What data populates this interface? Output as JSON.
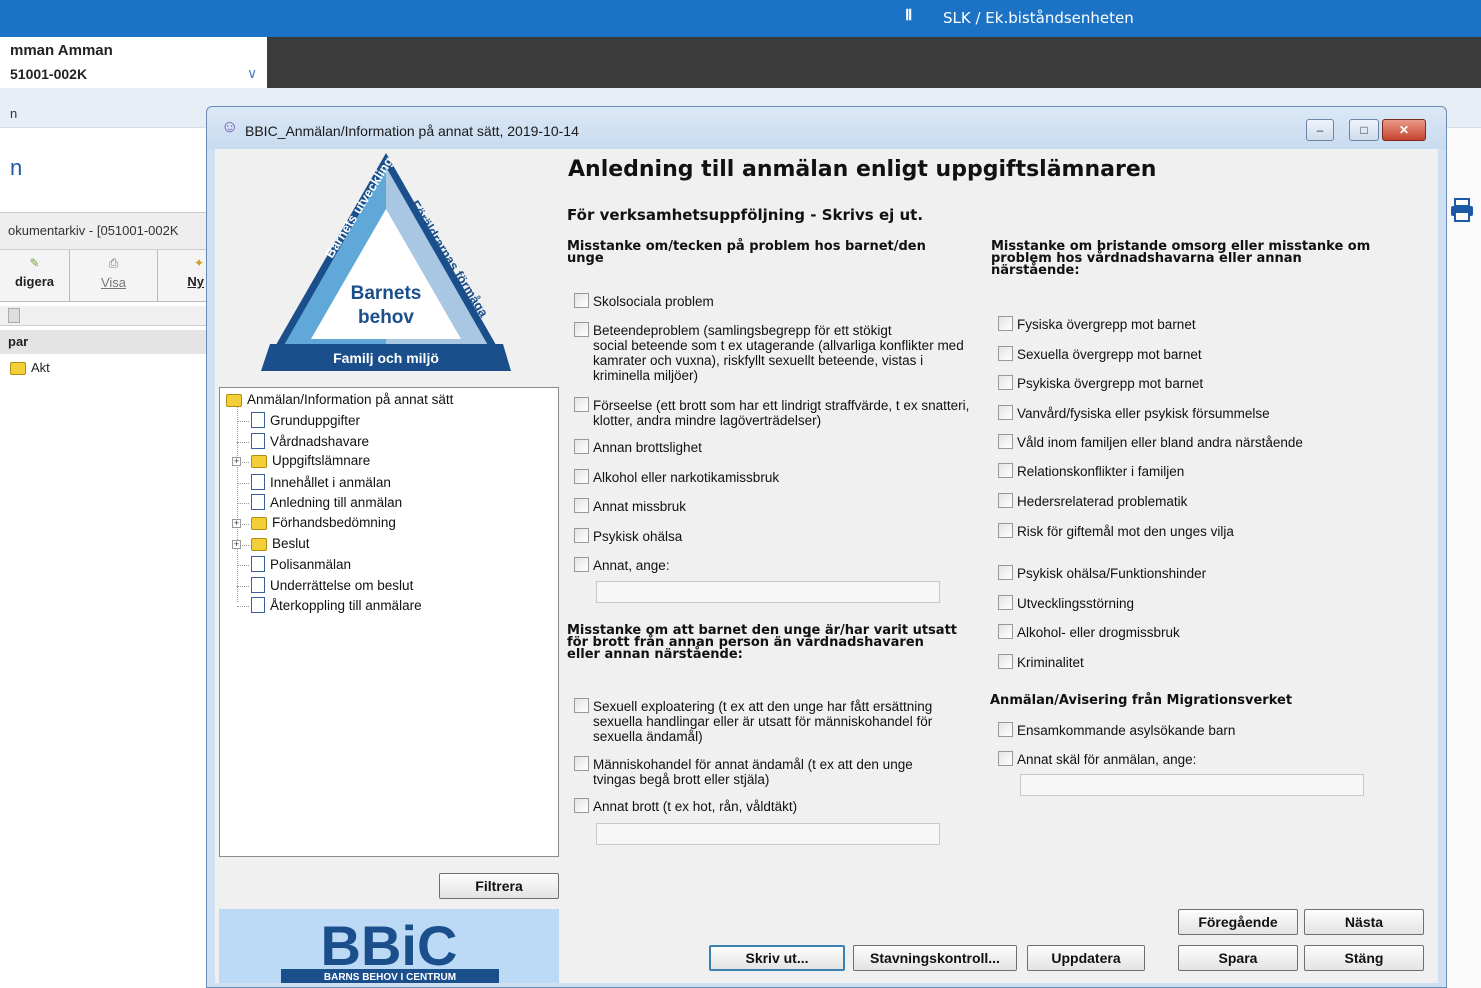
{
  "app": {
    "org_label": "SLK / Ek.biståndsenheten",
    "patient_name": "mman Amman",
    "patient_id": "51001-002K",
    "subnav_text": "n",
    "page_title_fragment": "n",
    "doc_archive_title": "okumentarkiv - [051001-002K",
    "toolbar": [
      {
        "label": "digera",
        "icon": "edit-icon"
      },
      {
        "label": "Visa",
        "icon": "view-icon"
      },
      {
        "label": "Ny",
        "icon": "new-icon"
      }
    ],
    "list_header": "par",
    "list_item": "Akt"
  },
  "dialog": {
    "title": "BBIC_Anmälan/Information på annat sätt, 2019-10-14",
    "window_buttons": {
      "minimize": "–",
      "maximize": "□",
      "close": "✕"
    },
    "logo_triangle": {
      "left": "Barnets utveckling",
      "right": "Föräldrarnas förmåga",
      "center": "Barnets behov",
      "bottom": "Familj och miljö"
    },
    "tree": {
      "root": "Anmälan/Information på annat sätt",
      "items": [
        {
          "label": "Grunduppgifter",
          "type": "doc",
          "expandable": false
        },
        {
          "label": "Vårdnadshavare",
          "type": "doc",
          "expandable": false
        },
        {
          "label": "Uppgiftslämnare",
          "type": "folder",
          "expandable": true
        },
        {
          "label": "Innehållet i anmälan",
          "type": "doc",
          "expandable": false
        },
        {
          "label": "Anledning till anmälan",
          "type": "doc",
          "expandable": false
        },
        {
          "label": "Förhandsbedömning",
          "type": "folder",
          "expandable": true
        },
        {
          "label": "Beslut",
          "type": "folder",
          "expandable": true
        },
        {
          "label": "Polisanmälan",
          "type": "doc",
          "expandable": false
        },
        {
          "label": "Underrättelse om beslut",
          "type": "doc",
          "expandable": false
        },
        {
          "label": "Återkoppling till anmälare",
          "type": "doc",
          "expandable": false
        }
      ]
    },
    "filter_button": "Filtrera",
    "bbic_logo": {
      "big": "BBiC",
      "small": "BARNS BEHOV I CENTRUM"
    },
    "heading": "Anledning till anmälan enligt uppgiftslämnaren",
    "subheading": "För verksamhetsuppföljning - Skrivs ej ut.",
    "left_section1": {
      "title": "Misstanke om/tecken på problem hos barnet/den\nunge",
      "options": [
        "Skolsociala problem",
        "Beteendeproblem (samlingsbegrepp för ett stökigt\nsocial beteende som t ex utagerande (allvarliga konflikter med\nkamrater och vuxna), riskfyllt sexuellt beteende, vistas i\nkriminella miljöer)",
        "Förseelse (ett brott som har ett lindrigt straffvärde, t ex snatteri,\nklotter, andra mindre lagöverträdelser)",
        "Annan brottslighet",
        "Alkohol eller narkotikamissbruk",
        "Annat missbruk",
        "Psykisk ohälsa",
        "Annat, ange:"
      ],
      "other_value": ""
    },
    "left_section2": {
      "title": "Misstanke om att barnet den unge är/har varit utsatt\nför brott från annan person än vårdnadshavaren\neller annan närstående:",
      "options": [
        "Sexuell exploatering (t ex att den unge har fått ersättning\nsexuella handlingar eller är utsatt för människohandel för\nsexuella ändamål)",
        "Människohandel för annat ändamål (t ex att den unge\ntvingas begå brott eller stjäla)",
        "Annat brott (t ex hot, rån, våldtäkt)"
      ],
      "other_value": ""
    },
    "right_section1": {
      "title": "Misstanke om bristande omsorg eller misstanke om\nproblem hos vårdnadshavarna eller annan\nnärstående:",
      "options": [
        "Fysiska övergrepp mot barnet",
        "Sexuella övergrepp mot barnet",
        "Psykiska övergrepp mot barnet",
        "Vanvård/fysiska eller psykisk försummelse",
        "Våld inom familjen eller bland andra närstående",
        "Relationskonflikter i familjen",
        "Hedersrelaterad problematik",
        "Risk för giftemål mot den unges vilja",
        "Psykisk ohälsa/Funktionshinder",
        "Utvecklingsstörning",
        "Alkohol- eller drogmissbruk",
        "Kriminalitet"
      ]
    },
    "right_section2": {
      "title": "Anmälan/Avisering från Migrationsverket",
      "options": [
        "Ensamkommande asylsökande barn",
        "Annat skäl för anmälan, ange:"
      ],
      "other_value": ""
    },
    "buttons": {
      "print": "Skriv ut...",
      "spellcheck": "Stavningskontroll...",
      "update": "Uppdatera",
      "previous": "Föregående",
      "next": "Nästa",
      "save": "Spara",
      "close": "Stäng"
    }
  }
}
